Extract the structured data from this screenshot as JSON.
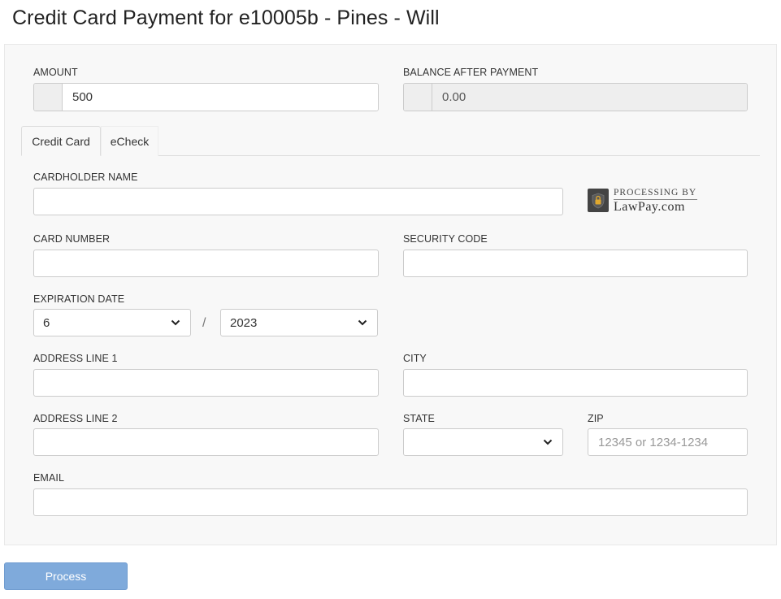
{
  "page": {
    "title": "Credit Card Payment for e10005b - Pines - Will"
  },
  "amount": {
    "label": "AMOUNT",
    "value": "500"
  },
  "balance": {
    "label": "BALANCE AFTER PAYMENT",
    "value": "0.00"
  },
  "tabs": [
    {
      "label": "Credit Card",
      "active": true
    },
    {
      "label": "eCheck",
      "active": false
    }
  ],
  "cardholder": {
    "label": "CARDHOLDER NAME",
    "value": ""
  },
  "lawpay": {
    "tagline": "PROCESSING BY",
    "brand": "LawPay.com",
    "icon": "padlock-icon"
  },
  "card_number": {
    "label": "CARD NUMBER",
    "value": ""
  },
  "security_code": {
    "label": "SECURITY CODE",
    "value": ""
  },
  "expiration": {
    "label": "EXPIRATION DATE",
    "month": "6",
    "separator": "/",
    "year": "2023"
  },
  "address1": {
    "label": "ADDRESS LINE 1",
    "value": ""
  },
  "city": {
    "label": "CITY",
    "value": ""
  },
  "address2": {
    "label": "ADDRESS LINE 2",
    "value": ""
  },
  "state": {
    "label": "STATE",
    "value": ""
  },
  "zip": {
    "label": "ZIP",
    "placeholder": "12345 or 1234-1234"
  },
  "email": {
    "label": "EMAIL",
    "value": ""
  },
  "process_button": {
    "label": "Process",
    "color": "#7faadb"
  }
}
